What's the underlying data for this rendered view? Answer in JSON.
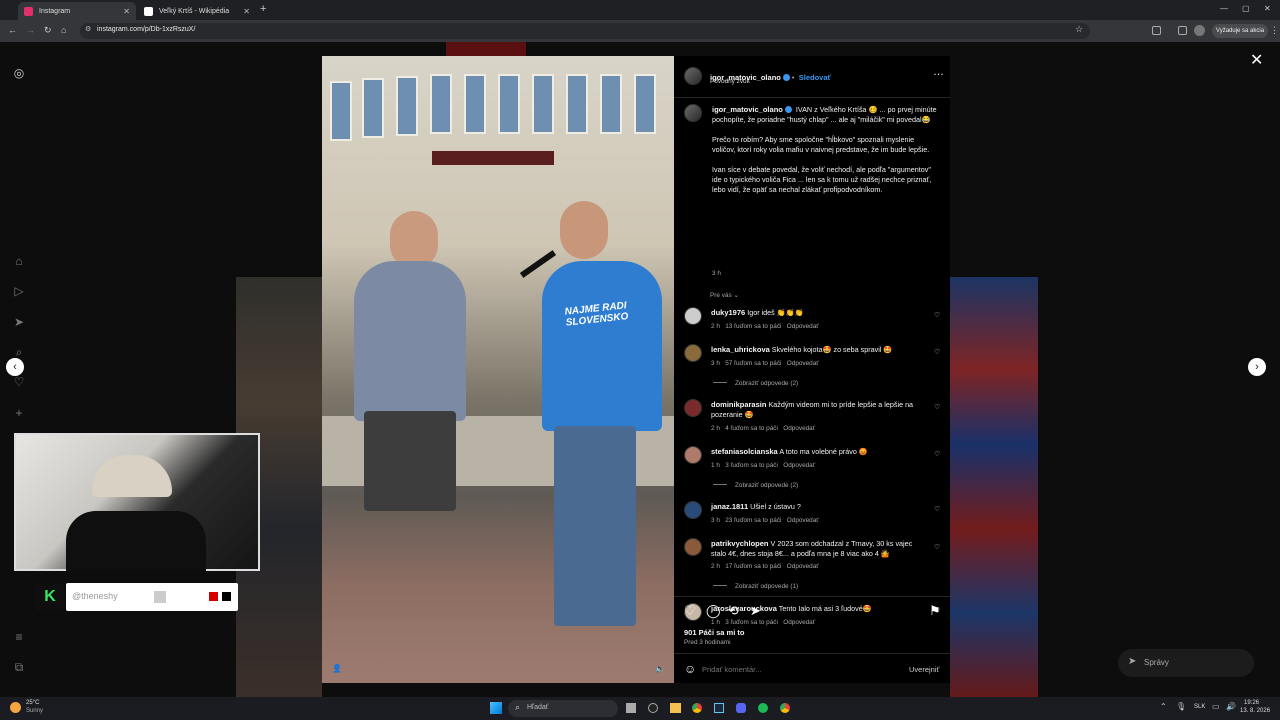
{
  "browser": {
    "tabs": [
      {
        "title": "Instagram",
        "favicon_color": "#e1306c",
        "active": true
      },
      {
        "title": "Veľký Krtíš - Wikipédia",
        "favicon_color": "#ffffff",
        "active": false
      }
    ],
    "url": "instagram.com/p/Db-1xzRszuX/",
    "signin_label": "Vyžaduje sa akcia"
  },
  "post": {
    "author": "igor_matovic_olano",
    "follow_label": "Sledovať",
    "audio_label": "Pôvodný zvuk",
    "caption_author": "igor_matovic_olano",
    "caption_p1": "IVAN z Veľkého Krtíša 🥴 ... po prvej minúte pochopíte, že poriadne \"hustý chlap\" ... ale aj \"miláčik\" mi povedal😂",
    "caption_p2": "Prečo to robím? Aby sme spoločne \"hĺbkovo\" spoznali myslenie voličov, ktorí roky volia mafiu v naivnej predstave, že im bude lepšie.",
    "caption_p3": "Ivan síce v debate povedal, že voliť nechodí, ale podľa \"argumentov\" ide o typického voliča Fica ... len sa k tomu už radšej nechce priznať, lebo vidí, že opäť sa nechal zlákať profipodvodníkom.",
    "caption_time": "3 h",
    "sort_label": "Pre vás",
    "likes": "901 Páči sa mi to",
    "posted": "Pred 3 hodinami",
    "comment_placeholder": "Pridať komentár...",
    "publish_label": "Uverejniť",
    "video_banner_text": "NAJME RADI SLOVENSKO"
  },
  "comments": [
    {
      "user": "duky1976",
      "text": "Igor ideš 👏👏👏",
      "time": "2 h",
      "likes": "13 ľuďom sa to páči",
      "reply": "Odpovedať"
    },
    {
      "user": "lenka_uhrickova",
      "text": "Skvelého kojota🤩 zo seba spravil 🤩",
      "time": "3 h",
      "likes": "57 ľuďom sa to páči",
      "reply": "Odpovedať",
      "view_replies": "Zobraziť odpovede (2)"
    },
    {
      "user": "dominikparasin",
      "text": "Každým videom mi to príde lepšie a lepšie na pozeranie 🤩",
      "time": "2 h",
      "likes": "4 ľuďom sa to páči",
      "reply": "Odpovedať"
    },
    {
      "user": "stefaniasolcianska",
      "text": "A toto ma volebné právo 😡",
      "time": "1 h",
      "likes": "3 ľuďom sa to páči",
      "reply": "Odpovedať",
      "view_replies": "Zobraziť odpovede (2)"
    },
    {
      "user": "janaz.1811",
      "text": "Ušiel z ústavu ?",
      "time": "3 h",
      "likes": "23 ľuďom sa to páči",
      "reply": "Odpovedať"
    },
    {
      "user": "patrikvychlopen",
      "text": "V 2023 som odchadzal z Trnavy, 30 ks vajec stalo 4€, dnes stoja 8€... a podľa mna je 8 viac ako 4 🤷",
      "time": "2 h",
      "likes": "17 ľuďom sa to páči",
      "reply": "Odpovedať",
      "view_replies": "Zobraziť odpovede (1)"
    },
    {
      "user": "jaroslavarouckova",
      "text": "Tento Ialo má asi 3 ľudové🤩",
      "time": "1 h",
      "likes": "3 ľuďom sa to páči",
      "reply": "Odpovedať"
    }
  ],
  "overlay": {
    "stream_handle": "@theneshy",
    "messages_label": "Správy"
  },
  "taskbar": {
    "temp": "25°C",
    "weather": "Sunny",
    "search_placeholder": "Hľadať",
    "lang": "SLK",
    "time": "19:26",
    "date": "13. 8. 2026"
  }
}
